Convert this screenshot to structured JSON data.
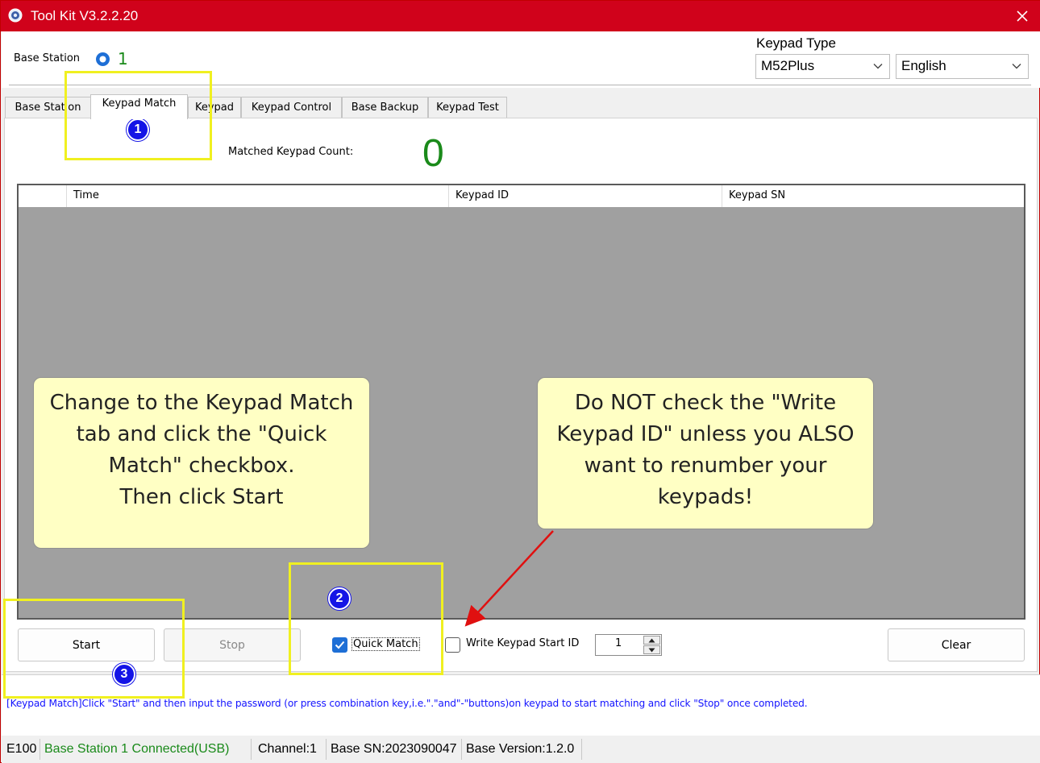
{
  "window": {
    "title": "Tool Kit  V3.2.2.20"
  },
  "header": {
    "base_station_label": "Base Station",
    "base_station_value": "1",
    "keypad_type_label": "Keypad Type",
    "keypad_type_selected": "M52Plus",
    "language_selected": "English"
  },
  "tabs": [
    {
      "label": "Base Station",
      "active": false
    },
    {
      "label": "Keypad Match",
      "active": true
    },
    {
      "label": "Keypad",
      "active": false
    },
    {
      "label": "Keypad Control",
      "active": false
    },
    {
      "label": "Base Backup",
      "active": false
    },
    {
      "label": "Keypad Test",
      "active": false
    }
  ],
  "match": {
    "count_label": "Matched Keypad Count:",
    "count_value": "0"
  },
  "table": {
    "columns": [
      "",
      "Time",
      "Keypad ID",
      "Keypad SN"
    ],
    "rows": []
  },
  "controls": {
    "start_label": "Start",
    "stop_label": "Stop",
    "quick_match_label": "Quick Match",
    "quick_match_checked": true,
    "write_start_id_label": "Write Keypad Start ID",
    "write_start_id_checked": false,
    "start_id_value": "1",
    "clear_label": "Clear"
  },
  "message": "[Keypad Match]Click \"Start\" and then input the password (or press combination key,i.e.\".\"and\"-\"buttons)on keypad to start matching and click \"Stop\" once completed.",
  "status": {
    "model": "E100",
    "connection": "Base Station 1 Connected(USB)",
    "channel": "Channel:1",
    "base_sn": "Base SN:2023090047",
    "base_version": "Base Version:1.2.0"
  },
  "annotations": {
    "badges": [
      "1",
      "2",
      "3"
    ],
    "callout_left": "Change to the Keypad Match\ntab and click the \"Quick\nMatch\" checkbox.\nThen click Start",
    "callout_right": "Do NOT check the \"Write\nKeypad ID\" unless you ALSO\nwant to renumber your\nkeypads!",
    "highlight_color": "#f0f020",
    "badge_color": "#1414e6",
    "callout_color": "#ffffc4",
    "arrow_color": "#e01010"
  },
  "colors": {
    "titlebar": "#d0021b",
    "accent_green": "#1a8a1a",
    "message_blue": "#1414ff",
    "checkbox_blue": "#1e6fd6"
  }
}
